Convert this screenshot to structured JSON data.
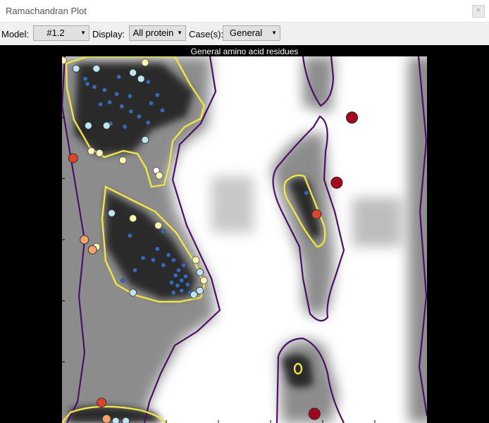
{
  "window": {
    "title": "Ramachandran Plot",
    "close_glyph": "×"
  },
  "toolbar": {
    "model_label": "Model:",
    "model_value": "#1.2",
    "display_label": "Display:",
    "display_value": "All protein",
    "cases_label": "Case(s):",
    "cases_value": "General"
  },
  "plot": {
    "title": "General amino acid residues",
    "x_ticks": 7,
    "y_ticks": 6
  },
  "colors": {
    "background": "#000000",
    "contour_outer": "#4b1064",
    "contour_inner": "#f0e442",
    "favored_blue": "#3a6bb0",
    "light_blue": "#bfe3f0",
    "pale_yellow": "#fef7b3",
    "orange": "#f6a46a",
    "red_orange": "#e0432d",
    "dark_red": "#a5051f"
  },
  "residues": [
    {
      "phi": -179,
      "psi": 176,
      "c": "y"
    },
    {
      "phi": -166,
      "psi": 168,
      "c": "l"
    },
    {
      "phi": -146,
      "psi": 168,
      "c": "l"
    },
    {
      "phi": -157,
      "psi": 158,
      "c": "b"
    },
    {
      "phi": -124,
      "psi": 160,
      "c": "b"
    },
    {
      "phi": -110,
      "psi": 164,
      "c": "l"
    },
    {
      "phi": -102,
      "psi": 158,
      "c": "l"
    },
    {
      "phi": -98,
      "psi": 174,
      "c": "y"
    },
    {
      "phi": -155,
      "psi": 153,
      "c": "b"
    },
    {
      "phi": -148,
      "psi": 150,
      "c": "b"
    },
    {
      "phi": -138,
      "psi": 147,
      "c": "b"
    },
    {
      "phi": -126,
      "psi": 143,
      "c": "b"
    },
    {
      "phi": -113,
      "psi": 141,
      "c": "b"
    },
    {
      "phi": -95,
      "psi": 155,
      "c": "b"
    },
    {
      "phi": -92,
      "psi": 134,
      "c": "b"
    },
    {
      "phi": -86,
      "psi": 142,
      "c": "b"
    },
    {
      "phi": -142,
      "psi": 133,
      "c": "b"
    },
    {
      "phi": -133,
      "psi": 135,
      "c": "b"
    },
    {
      "phi": -121,
      "psi": 131,
      "c": "b"
    },
    {
      "phi": -112,
      "psi": 126,
      "c": "b"
    },
    {
      "phi": -104,
      "psi": 121,
      "c": "b"
    },
    {
      "phi": -95,
      "psi": 115,
      "c": "b"
    },
    {
      "phi": -81,
      "psi": 127,
      "c": "b"
    },
    {
      "phi": -132,
      "psi": 114,
      "c": "b"
    },
    {
      "phi": -118,
      "psi": 111,
      "c": "b"
    },
    {
      "phi": -154,
      "psi": 112,
      "c": "l"
    },
    {
      "phi": -136,
      "psi": 112,
      "c": "l"
    },
    {
      "phi": -98,
      "psi": 98,
      "c": "l"
    },
    {
      "phi": -151,
      "psi": 87,
      "c": "y"
    },
    {
      "phi": -143,
      "psi": 85,
      "c": "y"
    },
    {
      "phi": -169,
      "psi": 80,
      "c": "r"
    },
    {
      "phi": -120,
      "psi": 78,
      "c": "y"
    },
    {
      "phi": -87,
      "psi": 68,
      "c": "w"
    },
    {
      "phi": -84,
      "psi": 63,
      "c": "y"
    },
    {
      "phi": -131,
      "psi": 26,
      "c": "l"
    },
    {
      "phi": -110,
      "psi": 21,
      "c": "y"
    },
    {
      "phi": -85,
      "psi": 14,
      "c": "y"
    },
    {
      "phi": -113,
      "psi": 4,
      "c": "b"
    },
    {
      "phi": -158,
      "psi": 0,
      "c": "o"
    },
    {
      "phi": -146,
      "psi": -7,
      "c": "y"
    },
    {
      "phi": -80,
      "psi": 8,
      "c": "b"
    },
    {
      "phi": -86,
      "psi": -9,
      "c": "b"
    },
    {
      "phi": -90,
      "psi": -20,
      "c": "b"
    },
    {
      "phi": -80,
      "psi": -25,
      "c": "b"
    },
    {
      "phi": -100,
      "psi": -18,
      "c": "b"
    },
    {
      "phi": -75,
      "psi": -15,
      "c": "b"
    },
    {
      "phi": -70,
      "psi": -20,
      "c": "b"
    },
    {
      "phi": -65,
      "psi": -30,
      "c": "b"
    },
    {
      "phi": -60,
      "psi": -25,
      "c": "b"
    },
    {
      "phi": -68,
      "psi": -35,
      "c": "b"
    },
    {
      "phi": -62,
      "psi": -40,
      "c": "b"
    },
    {
      "phi": -58,
      "psi": -36,
      "c": "b"
    },
    {
      "phi": -72,
      "psi": -42,
      "c": "b"
    },
    {
      "phi": -66,
      "psi": -45,
      "c": "b"
    },
    {
      "phi": -56,
      "psi": -44,
      "c": "b"
    },
    {
      "phi": -62,
      "psi": -50,
      "c": "b"
    },
    {
      "phi": -54,
      "psi": -52,
      "c": "b"
    },
    {
      "phi": -70,
      "psi": -52,
      "c": "b"
    },
    {
      "phi": -108,
      "psi": -30,
      "c": "b"
    },
    {
      "phi": -120,
      "psi": -40,
      "c": "b"
    },
    {
      "phi": -150,
      "psi": -10,
      "c": "o"
    },
    {
      "phi": -48,
      "psi": -20,
      "c": "y"
    },
    {
      "phi": -44,
      "psi": -32,
      "c": "l"
    },
    {
      "phi": -40,
      "psi": -40,
      "c": "y"
    },
    {
      "phi": -110,
      "psi": -52,
      "c": "l"
    },
    {
      "phi": -44,
      "psi": -50,
      "c": "l"
    },
    {
      "phi": -50,
      "psi": -54,
      "c": "l"
    },
    {
      "phi": -141,
      "psi": -160,
      "c": "r"
    },
    {
      "phi": -136,
      "psi": -176,
      "c": "o"
    },
    {
      "phi": -127,
      "psi": -178,
      "c": "l"
    },
    {
      "phi": -117,
      "psi": -178,
      "c": "l"
    },
    {
      "phi": 61,
      "psi": 46,
      "c": "b"
    },
    {
      "phi": 71,
      "psi": 25,
      "c": "r"
    },
    {
      "phi": 91,
      "psi": 56,
      "c": "d"
    },
    {
      "phi": 106,
      "psi": 120,
      "c": "d"
    },
    {
      "phi": 69,
      "psi": -171,
      "c": "d"
    }
  ]
}
